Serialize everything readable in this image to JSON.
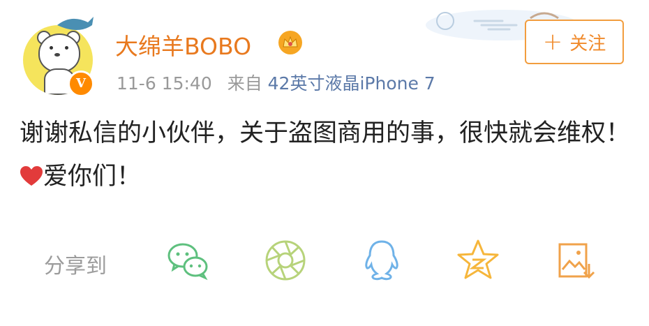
{
  "user": {
    "name": "大绵羊BOBO",
    "vip_badge": "V",
    "timestamp": "11-6 15:40",
    "source_prefix": "来自",
    "source": "42英寸液晶iPhone 7"
  },
  "follow_button": {
    "icon": "plus-icon",
    "label": "关注"
  },
  "post": {
    "text_part1": "谢谢私信的小伙伴，关于盗图商用的事，很快就会维权！",
    "emoji": "heart-icon",
    "text_part2": "爱你们！"
  },
  "share": {
    "label": "分享到",
    "targets": [
      "wechat-icon",
      "moments-icon",
      "qq-icon",
      "qzone-icon",
      "save-image-icon"
    ]
  },
  "colors": {
    "username": "#e8791e",
    "vip_badge": "#ff8a00",
    "link": "#5b79a8",
    "follow_border": "#f29d3e",
    "icon_wechat": "#5ec07e",
    "icon_moments": "#b7d37a",
    "icon_qq": "#6fb2e8",
    "icon_qzone": "#f6b63b",
    "icon_save": "#f0a24a"
  }
}
